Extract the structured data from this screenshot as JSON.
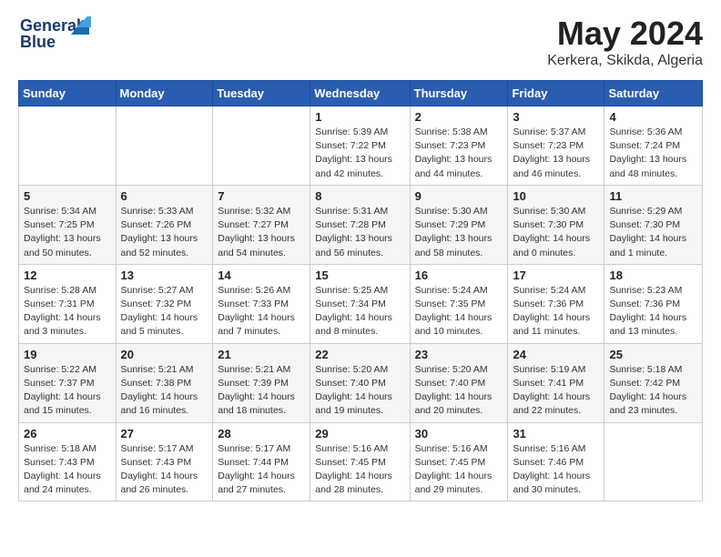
{
  "header": {
    "logo_line1": "General",
    "logo_line2": "Blue",
    "month": "May 2024",
    "location": "Kerkera, Skikda, Algeria"
  },
  "weekdays": [
    "Sunday",
    "Monday",
    "Tuesday",
    "Wednesday",
    "Thursday",
    "Friday",
    "Saturday"
  ],
  "weeks": [
    [
      {
        "day": "",
        "sunrise": "",
        "sunset": "",
        "daylight": ""
      },
      {
        "day": "",
        "sunrise": "",
        "sunset": "",
        "daylight": ""
      },
      {
        "day": "",
        "sunrise": "",
        "sunset": "",
        "daylight": ""
      },
      {
        "day": "1",
        "sunrise": "Sunrise: 5:39 AM",
        "sunset": "Sunset: 7:22 PM",
        "daylight": "Daylight: 13 hours and 42 minutes."
      },
      {
        "day": "2",
        "sunrise": "Sunrise: 5:38 AM",
        "sunset": "Sunset: 7:23 PM",
        "daylight": "Daylight: 13 hours and 44 minutes."
      },
      {
        "day": "3",
        "sunrise": "Sunrise: 5:37 AM",
        "sunset": "Sunset: 7:23 PM",
        "daylight": "Daylight: 13 hours and 46 minutes."
      },
      {
        "day": "4",
        "sunrise": "Sunrise: 5:36 AM",
        "sunset": "Sunset: 7:24 PM",
        "daylight": "Daylight: 13 hours and 48 minutes."
      }
    ],
    [
      {
        "day": "5",
        "sunrise": "Sunrise: 5:34 AM",
        "sunset": "Sunset: 7:25 PM",
        "daylight": "Daylight: 13 hours and 50 minutes."
      },
      {
        "day": "6",
        "sunrise": "Sunrise: 5:33 AM",
        "sunset": "Sunset: 7:26 PM",
        "daylight": "Daylight: 13 hours and 52 minutes."
      },
      {
        "day": "7",
        "sunrise": "Sunrise: 5:32 AM",
        "sunset": "Sunset: 7:27 PM",
        "daylight": "Daylight: 13 hours and 54 minutes."
      },
      {
        "day": "8",
        "sunrise": "Sunrise: 5:31 AM",
        "sunset": "Sunset: 7:28 PM",
        "daylight": "Daylight: 13 hours and 56 minutes."
      },
      {
        "day": "9",
        "sunrise": "Sunrise: 5:30 AM",
        "sunset": "Sunset: 7:29 PM",
        "daylight": "Daylight: 13 hours and 58 minutes."
      },
      {
        "day": "10",
        "sunrise": "Sunrise: 5:30 AM",
        "sunset": "Sunset: 7:30 PM",
        "daylight": "Daylight: 14 hours and 0 minutes."
      },
      {
        "day": "11",
        "sunrise": "Sunrise: 5:29 AM",
        "sunset": "Sunset: 7:30 PM",
        "daylight": "Daylight: 14 hours and 1 minute."
      }
    ],
    [
      {
        "day": "12",
        "sunrise": "Sunrise: 5:28 AM",
        "sunset": "Sunset: 7:31 PM",
        "daylight": "Daylight: 14 hours and 3 minutes."
      },
      {
        "day": "13",
        "sunrise": "Sunrise: 5:27 AM",
        "sunset": "Sunset: 7:32 PM",
        "daylight": "Daylight: 14 hours and 5 minutes."
      },
      {
        "day": "14",
        "sunrise": "Sunrise: 5:26 AM",
        "sunset": "Sunset: 7:33 PM",
        "daylight": "Daylight: 14 hours and 7 minutes."
      },
      {
        "day": "15",
        "sunrise": "Sunrise: 5:25 AM",
        "sunset": "Sunset: 7:34 PM",
        "daylight": "Daylight: 14 hours and 8 minutes."
      },
      {
        "day": "16",
        "sunrise": "Sunrise: 5:24 AM",
        "sunset": "Sunset: 7:35 PM",
        "daylight": "Daylight: 14 hours and 10 minutes."
      },
      {
        "day": "17",
        "sunrise": "Sunrise: 5:24 AM",
        "sunset": "Sunset: 7:36 PM",
        "daylight": "Daylight: 14 hours and 11 minutes."
      },
      {
        "day": "18",
        "sunrise": "Sunrise: 5:23 AM",
        "sunset": "Sunset: 7:36 PM",
        "daylight": "Daylight: 14 hours and 13 minutes."
      }
    ],
    [
      {
        "day": "19",
        "sunrise": "Sunrise: 5:22 AM",
        "sunset": "Sunset: 7:37 PM",
        "daylight": "Daylight: 14 hours and 15 minutes."
      },
      {
        "day": "20",
        "sunrise": "Sunrise: 5:21 AM",
        "sunset": "Sunset: 7:38 PM",
        "daylight": "Daylight: 14 hours and 16 minutes."
      },
      {
        "day": "21",
        "sunrise": "Sunrise: 5:21 AM",
        "sunset": "Sunset: 7:39 PM",
        "daylight": "Daylight: 14 hours and 18 minutes."
      },
      {
        "day": "22",
        "sunrise": "Sunrise: 5:20 AM",
        "sunset": "Sunset: 7:40 PM",
        "daylight": "Daylight: 14 hours and 19 minutes."
      },
      {
        "day": "23",
        "sunrise": "Sunrise: 5:20 AM",
        "sunset": "Sunset: 7:40 PM",
        "daylight": "Daylight: 14 hours and 20 minutes."
      },
      {
        "day": "24",
        "sunrise": "Sunrise: 5:19 AM",
        "sunset": "Sunset: 7:41 PM",
        "daylight": "Daylight: 14 hours and 22 minutes."
      },
      {
        "day": "25",
        "sunrise": "Sunrise: 5:18 AM",
        "sunset": "Sunset: 7:42 PM",
        "daylight": "Daylight: 14 hours and 23 minutes."
      }
    ],
    [
      {
        "day": "26",
        "sunrise": "Sunrise: 5:18 AM",
        "sunset": "Sunset: 7:43 PM",
        "daylight": "Daylight: 14 hours and 24 minutes."
      },
      {
        "day": "27",
        "sunrise": "Sunrise: 5:17 AM",
        "sunset": "Sunset: 7:43 PM",
        "daylight": "Daylight: 14 hours and 26 minutes."
      },
      {
        "day": "28",
        "sunrise": "Sunrise: 5:17 AM",
        "sunset": "Sunset: 7:44 PM",
        "daylight": "Daylight: 14 hours and 27 minutes."
      },
      {
        "day": "29",
        "sunrise": "Sunrise: 5:16 AM",
        "sunset": "Sunset: 7:45 PM",
        "daylight": "Daylight: 14 hours and 28 minutes."
      },
      {
        "day": "30",
        "sunrise": "Sunrise: 5:16 AM",
        "sunset": "Sunset: 7:45 PM",
        "daylight": "Daylight: 14 hours and 29 minutes."
      },
      {
        "day": "31",
        "sunrise": "Sunrise: 5:16 AM",
        "sunset": "Sunset: 7:46 PM",
        "daylight": "Daylight: 14 hours and 30 minutes."
      },
      {
        "day": "",
        "sunrise": "",
        "sunset": "",
        "daylight": ""
      }
    ]
  ]
}
